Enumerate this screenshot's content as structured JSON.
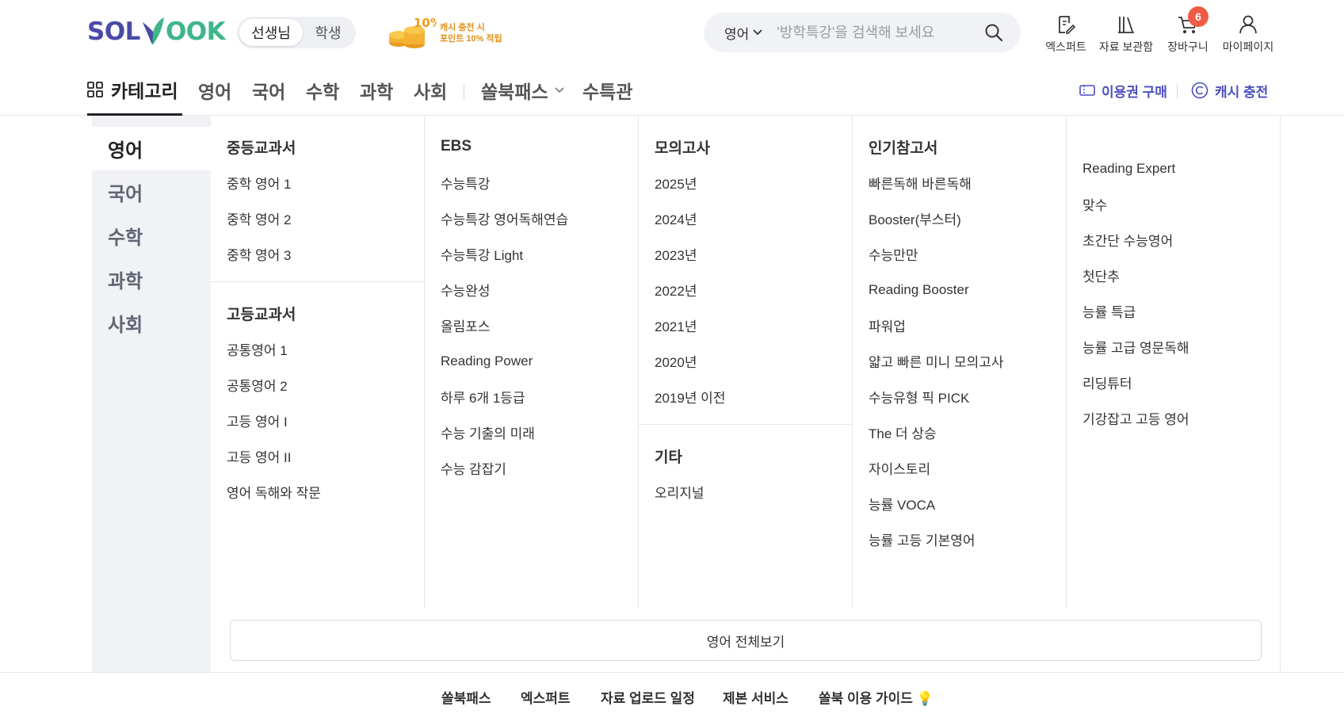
{
  "header": {
    "logo": {
      "part1": "SOL",
      "part2": "OOK"
    },
    "roles": [
      "선생님",
      "학생"
    ],
    "promo": {
      "badge": "10%",
      "line1": "캐시 충전 시",
      "line2": "포인트 10% 적립"
    },
    "search": {
      "category": "영어",
      "placeholder": "'방학특강'을 검색해 보세요"
    },
    "utilities": [
      {
        "label": "엑스퍼트",
        "icon": "edit-document-icon"
      },
      {
        "label": "자료 보관함",
        "icon": "library-icon"
      },
      {
        "label": "장바구니",
        "icon": "cart-icon",
        "badge": "6"
      },
      {
        "label": "마이페이지",
        "icon": "user-icon"
      }
    ]
  },
  "nav": {
    "category": "카테고리",
    "items": [
      "영어",
      "국어",
      "수학",
      "과학",
      "사회"
    ],
    "extra": [
      "쏠북패스",
      "수특관"
    ],
    "right": [
      "이용권 구매",
      "캐시 충전"
    ]
  },
  "menu": {
    "sidebar": [
      "영어",
      "국어",
      "수학",
      "과학",
      "사회"
    ],
    "columns": [
      {
        "groups": [
          {
            "title": "중등교과서",
            "links": [
              "중학 영어 1",
              "중학 영어 2",
              "중학 영어 3"
            ]
          },
          {
            "title": "고등교과서",
            "links": [
              "공통영어 1",
              "공통영어 2",
              "고등 영어 I",
              "고등 영어 II",
              "영어 독해와 작문"
            ]
          }
        ]
      },
      {
        "groups": [
          {
            "title": "EBS",
            "links": [
              "수능특강",
              "수능특강 영어독해연습",
              "수능특강 Light",
              "수능완성",
              "올림포스",
              "Reading Power",
              "하루 6개 1등급",
              "수능 기출의 미래",
              "수능 감잡기"
            ]
          }
        ]
      },
      {
        "groups": [
          {
            "title": "모의고사",
            "links": [
              "2025년",
              "2024년",
              "2023년",
              "2022년",
              "2021년",
              "2020년",
              "2019년 이전"
            ]
          },
          {
            "title": "기타",
            "links": [
              "오리지널"
            ]
          }
        ]
      },
      {
        "groups": [
          {
            "title": "인기참고서",
            "links": [
              "빠른독해 바른독해",
              "Booster(부스터)",
              "수능만만",
              "Reading Booster",
              "파워업",
              "얇고 빠른 미니 모의고사",
              "수능유형 픽 PICK",
              "The 더 상승",
              "자이스토리",
              "능률 VOCA",
              "능률 고등 기본영어"
            ]
          }
        ]
      },
      {
        "groups": [
          {
            "title": "",
            "links": [
              "Reading Expert",
              "맞수",
              "초간단 수능영어",
              "첫단추",
              "능률 특급",
              "능률 고급 영문독해",
              "리딩튜터",
              "기강잡고 고등 영어"
            ]
          }
        ]
      }
    ],
    "view_all": "영어 전체보기"
  },
  "footer": {
    "links": [
      "쏠북패스",
      "엑스퍼트",
      "자료 업로드 일정",
      "제본 서비스",
      "쏠북 이용 가이드 💡"
    ]
  },
  "colors": {
    "brand_purple": "#4a4aa8",
    "brand_green": "#3fb58a",
    "accent_blue": "#4b4fc0",
    "badge_red": "#ef5b44"
  }
}
